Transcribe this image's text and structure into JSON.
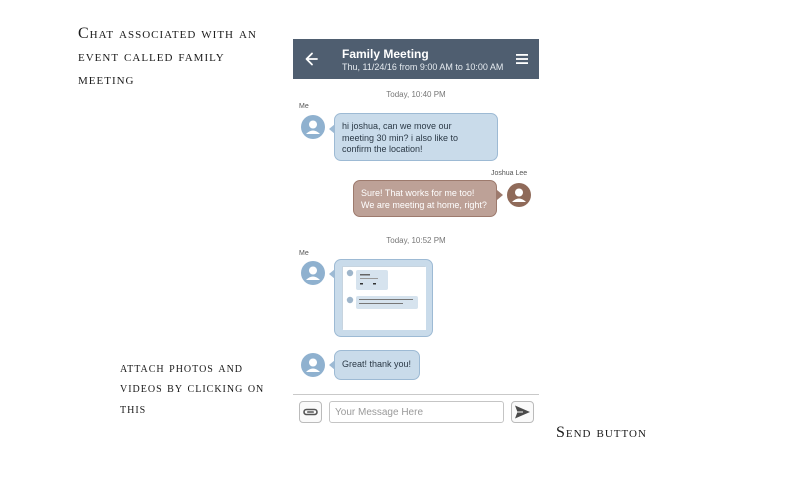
{
  "annotations": {
    "chat": "Chat associated with an event called family meeting",
    "attach": "attach photos and videos by clicking on this",
    "send": "Send button"
  },
  "header": {
    "title": "Family Meeting",
    "subtitle": "Thu, 11/24/16 from 9:00 AM to 10:00 AM",
    "back_icon": "arrow-left-icon",
    "menu_icon": "hamburger-menu-icon",
    "background": "#4f5e70"
  },
  "messages": [
    {
      "timestamp": "Today, 10:40 PM"
    },
    {
      "sender": "Me",
      "text": "hi joshua, can we move our meeting 30 min? i also like to confirm the location!",
      "line1": "hi joshua, can we move our",
      "line2": "meeting 30 min? i also like to",
      "line3": "confirm the location!"
    },
    {
      "sender": "Joshua Lee",
      "line1": "Sure! That works for me too!",
      "line2": "We are meeting at home, right?"
    },
    {
      "timestamp": "Today, 10:52 PM"
    },
    {
      "sender": "Me",
      "type": "image"
    },
    {
      "sender": "Me",
      "text": "Great! thank you!"
    }
  ],
  "composer": {
    "placeholder": "Your Message Here",
    "attach_icon": "paperclip-icon",
    "send_icon": "paper-plane-send-icon"
  },
  "colors": {
    "me_bubble": "#c9dbea",
    "other_bubble": "#bda197",
    "me_avatar": "#8fb1cf",
    "other_avatar": "#8f6a59"
  }
}
